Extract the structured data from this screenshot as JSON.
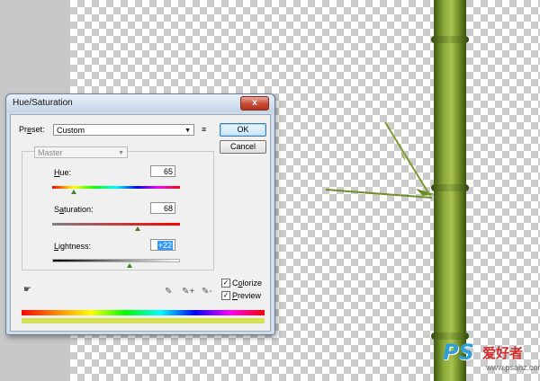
{
  "dialog": {
    "title": "Hue/Saturation",
    "close_label": "x",
    "preset_label_prefix": "Pr",
    "preset_label_mnemonic": "e",
    "preset_label_suffix": "set:",
    "preset_value": "Custom",
    "preset_menu_icon": "≡",
    "ok_label": "OK",
    "cancel_label": "Cancel",
    "channel_value": "Master",
    "hue": {
      "label_mnemonic": "H",
      "label_rest": "ue:",
      "value": "65",
      "slider_fraction": 0.32
    },
    "saturation": {
      "label_pre": "S",
      "label_mnemonic": "a",
      "label_rest": "turation:",
      "value": "68",
      "slider_fraction": 0.67
    },
    "lightness": {
      "label_mnemonic": "L",
      "label_rest": "ightness:",
      "value": "+22",
      "slider_fraction": 0.61
    },
    "colorize": {
      "label_mnemonic": "o",
      "label_pre": "C",
      "label_rest": "lorize",
      "checked": true,
      "check_glyph": "✓"
    },
    "preview": {
      "label_mnemonic": "P",
      "label_rest": "review",
      "checked": true,
      "check_glyph": "✓"
    },
    "tools": {
      "target_adjust_icon": "☛",
      "eyedropper_icon": "✎",
      "eyedropper_plus_icon": "✎+",
      "eyedropper_minus_icon": "✎-"
    },
    "colorized_swatch_color": "#d6e05a"
  },
  "watermark": {
    "logo": "PS",
    "chinese": "爱好者",
    "url": "www.psahz.com"
  }
}
